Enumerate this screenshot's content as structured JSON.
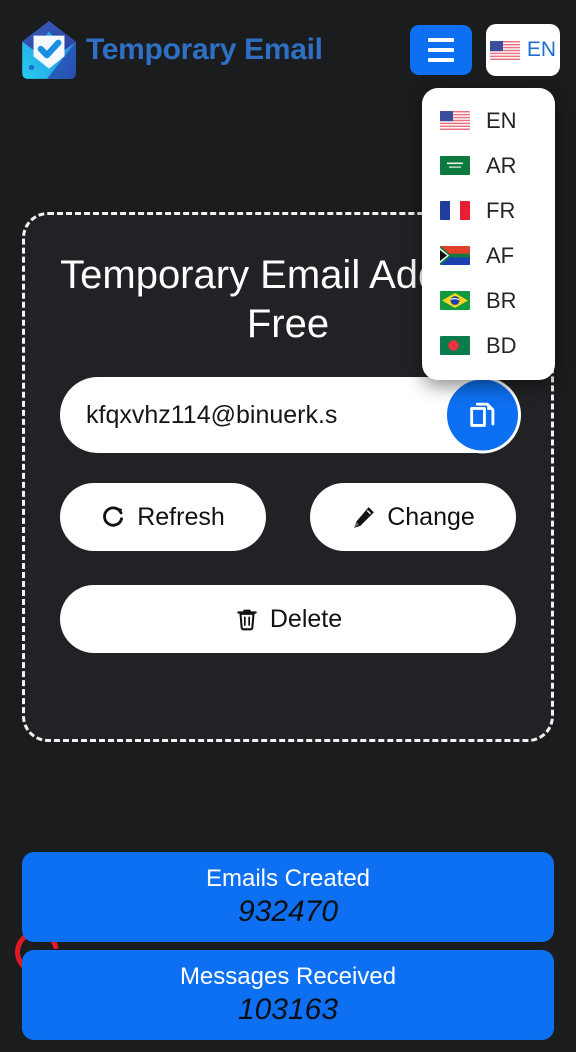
{
  "header": {
    "brand_title": "Temporary Email",
    "logo_icon": "envelope-check-logo",
    "menu_icon": "hamburger-menu-icon",
    "language_button": {
      "code": "EN",
      "flag": "us-flag-icon"
    }
  },
  "language_dropdown": {
    "open": true,
    "options": [
      {
        "code": "EN",
        "flag": "us-flag-icon"
      },
      {
        "code": "AR",
        "flag": "sa-flag-icon"
      },
      {
        "code": "FR",
        "flag": "fr-flag-icon"
      },
      {
        "code": "AF",
        "flag": "za-flag-icon"
      },
      {
        "code": "BR",
        "flag": "br-flag-icon"
      },
      {
        "code": "BD",
        "flag": "bd-flag-icon"
      }
    ]
  },
  "hero": {
    "title": "Temporary Email Address Free",
    "email": {
      "value": "kfqxvhz114@binuerk.s",
      "copy_icon": "copy-icon"
    },
    "actions": [
      {
        "label": "Refresh",
        "icon": "refresh-icon"
      },
      {
        "label": "Change",
        "icon": "pencil-icon"
      },
      {
        "label": "Delete",
        "icon": "trash-icon"
      }
    ]
  },
  "stats": [
    {
      "label": "Emails Created",
      "value": "932470"
    },
    {
      "label": "Messages Received",
      "value": "103163"
    }
  ],
  "loading_spinner": {
    "icon": "loading-spinner-icon",
    "color": "#e01b24"
  },
  "colors": {
    "background": "#1a1c1e",
    "card_background": "#202225",
    "accent_blue": "#0d70f2",
    "brand_blue": "#2f6fc4",
    "white": "#ffffff",
    "spinner_red": "#e01b24"
  }
}
